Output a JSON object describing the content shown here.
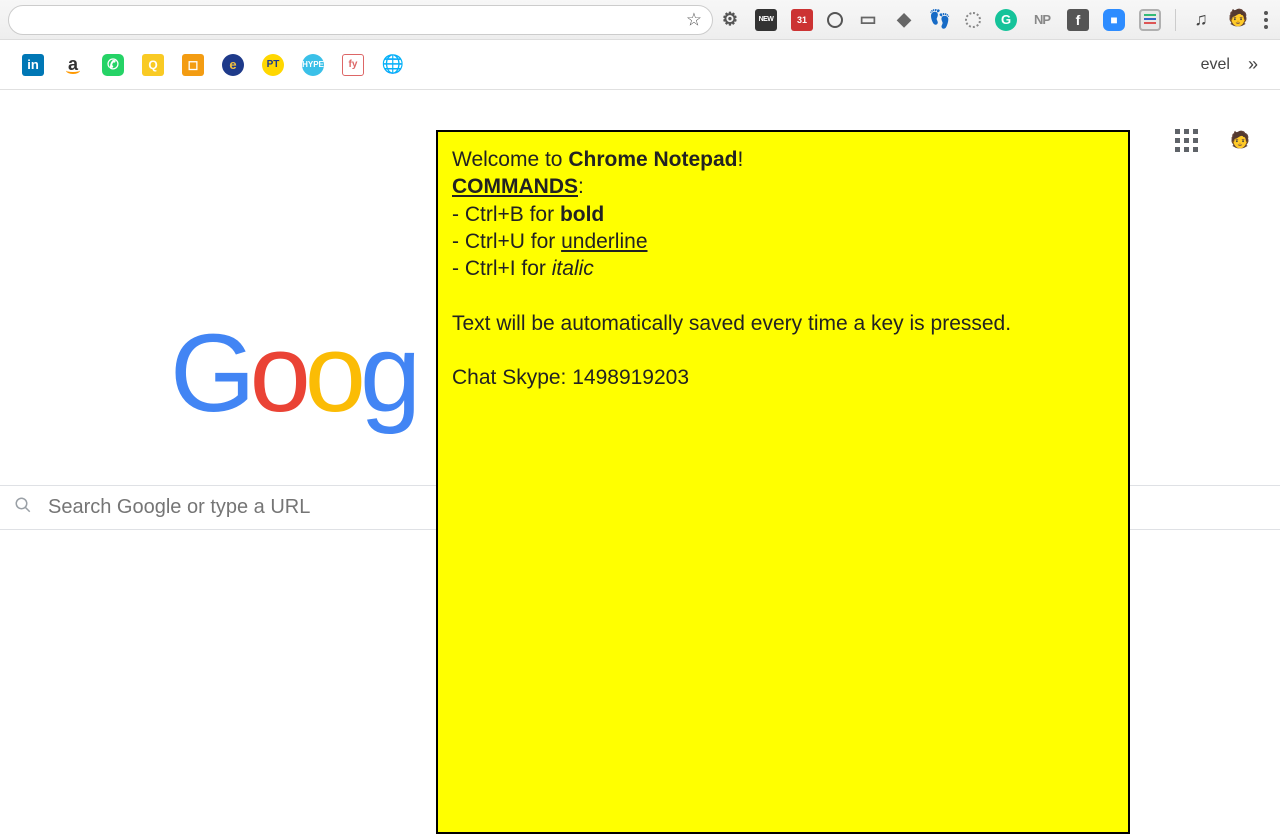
{
  "toolbar": {
    "extensions": [
      "gear",
      "new",
      "calendar-31",
      "empty-circle",
      "display",
      "stack",
      "foot",
      "donut",
      "grammarly",
      "np",
      "facebook",
      "zoom",
      "notepad"
    ],
    "calendar_day": "31",
    "np_label": "NP"
  },
  "bookmarks": {
    "visible_text_item": "evel",
    "more_symbol": "»"
  },
  "google": {
    "logo_letters": [
      "G",
      "o",
      "o",
      "g"
    ]
  },
  "search": {
    "placeholder": "Search Google or type a URL"
  },
  "notepad": {
    "welcome_prefix": "Welcome to ",
    "welcome_app": "Chrome Notepad",
    "welcome_suffix": "!",
    "commands_label": "COMMANDS",
    "commands_colon": ":",
    "cmd_bold_prefix": "- Ctrl+B for ",
    "cmd_bold_word": "bold",
    "cmd_underline_prefix": "- Ctrl+U for ",
    "cmd_underline_word": "underline",
    "cmd_italic_prefix": "- Ctrl+I for ",
    "cmd_italic_word": "italic",
    "autosave": "Text will be automatically saved every time a key is pressed.",
    "skype": "Chat Skype: 1498919203"
  }
}
